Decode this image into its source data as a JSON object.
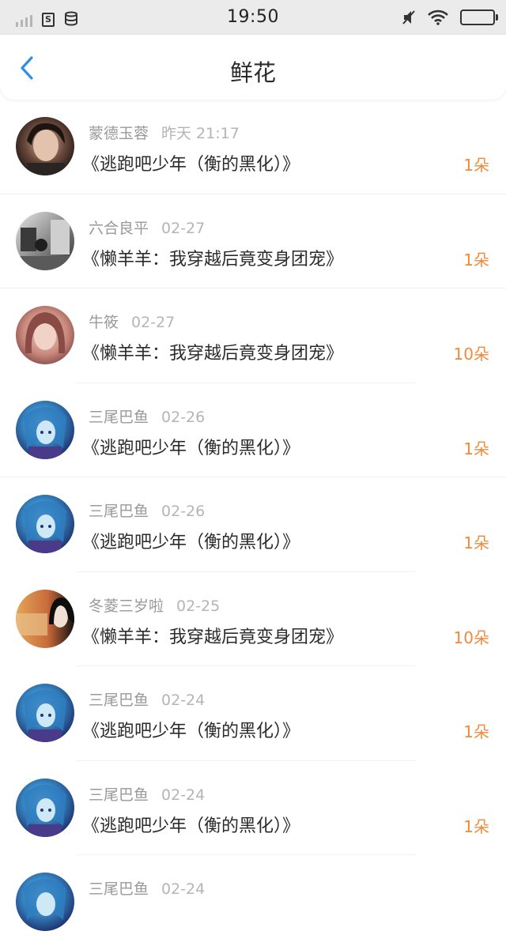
{
  "status_bar": {
    "time": "19:50",
    "sim_label": "S"
  },
  "nav": {
    "title": "鲜花"
  },
  "items": [
    {
      "user": "蒙德玉蓉",
      "date": "昨天 21:17",
      "book": "《逃跑吧少年（衡的黑化）》",
      "count": "1朵",
      "avatar": "avatar-girl-dark"
    },
    {
      "user": "六合良平",
      "date": "02-27",
      "book": "《懒羊羊：我穿越后竟变身团宠》",
      "count": "1朵",
      "avatar": "avatar-bw-street"
    },
    {
      "user": "牛筱",
      "date": "02-27",
      "book": "《懒羊羊：我穿越后竟变身团宠》",
      "count": "10朵",
      "avatar": "avatar-girl-pink"
    },
    {
      "user": "三尾巴鱼",
      "date": "02-26",
      "book": "《逃跑吧少年（衡的黑化）》",
      "count": "1朵",
      "avatar": "avatar-anime-blue"
    },
    {
      "user": "三尾巴鱼",
      "date": "02-26",
      "book": "《逃跑吧少年（衡的黑化）》",
      "count": "1朵",
      "avatar": "avatar-anime-blue"
    },
    {
      "user": "冬菱三岁啦",
      "date": "02-25",
      "book": "《懒羊羊：我穿越后竟变身团宠》",
      "count": "10朵",
      "avatar": "avatar-girl-warm"
    },
    {
      "user": "三尾巴鱼",
      "date": "02-24",
      "book": "《逃跑吧少年（衡的黑化）》",
      "count": "1朵",
      "avatar": "avatar-anime-blue"
    },
    {
      "user": "三尾巴鱼",
      "date": "02-24",
      "book": "《逃跑吧少年（衡的黑化）》",
      "count": "1朵",
      "avatar": "avatar-anime-blue"
    },
    {
      "user": "三尾巴鱼",
      "date": "02-24",
      "book": "",
      "count": "",
      "avatar": "avatar-anime-blue"
    }
  ],
  "colors": {
    "accent_blue": "#2f8fe8",
    "count_orange": "#f08a3a",
    "status_bar_bg": "#ebebeb"
  }
}
